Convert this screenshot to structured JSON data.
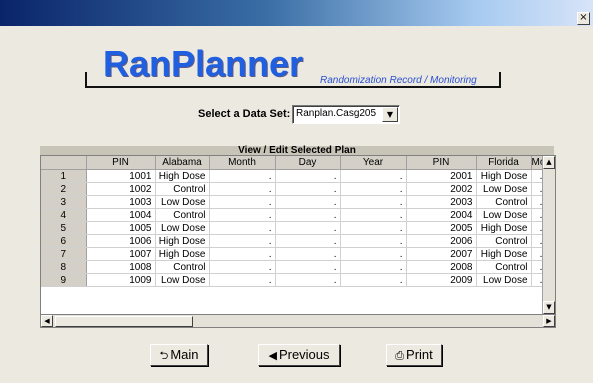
{
  "window": {
    "close_glyph": "×"
  },
  "logo": {
    "title": "RanPlanner",
    "subtitle": "Randomization Record / Monitoring"
  },
  "dataset": {
    "label": "Select a Data Set:",
    "value": "Ranplan.Casg205"
  },
  "grid": {
    "title": "View / Edit Selected Plan",
    "columns": [
      "",
      "PIN",
      "Alabama",
      "Month",
      "Day",
      "Year",
      "PIN",
      "Florida",
      "Mo"
    ],
    "rows": [
      [
        "1",
        "1001",
        "High Dose",
        ".",
        ".",
        ".",
        "2001",
        "High Dose",
        "."
      ],
      [
        "2",
        "1002",
        "Control",
        ".",
        ".",
        ".",
        "2002",
        "Low Dose",
        "."
      ],
      [
        "3",
        "1003",
        "Low Dose",
        ".",
        ".",
        ".",
        "2003",
        "Control",
        "."
      ],
      [
        "4",
        "1004",
        "Control",
        ".",
        ".",
        ".",
        "2004",
        "Low Dose",
        "."
      ],
      [
        "5",
        "1005",
        "Low Dose",
        ".",
        ".",
        ".",
        "2005",
        "High Dose",
        "."
      ],
      [
        "6",
        "1006",
        "High Dose",
        ".",
        ".",
        ".",
        "2006",
        "Control",
        "."
      ],
      [
        "7",
        "1007",
        "High Dose",
        ".",
        ".",
        ".",
        "2007",
        "High Dose",
        "."
      ],
      [
        "8",
        "1008",
        "Control",
        ".",
        ".",
        ".",
        "2008",
        "Control",
        "."
      ],
      [
        "9",
        "1009",
        "Low Dose",
        ".",
        ".",
        ".",
        "2009",
        "Low Dose",
        "."
      ]
    ]
  },
  "buttons": {
    "main": "Main",
    "previous": "Previous",
    "print": "Print"
  },
  "icons": {
    "main": "return-arrow-icon",
    "previous": "left-arrow-icon",
    "print": "printer-icon"
  }
}
